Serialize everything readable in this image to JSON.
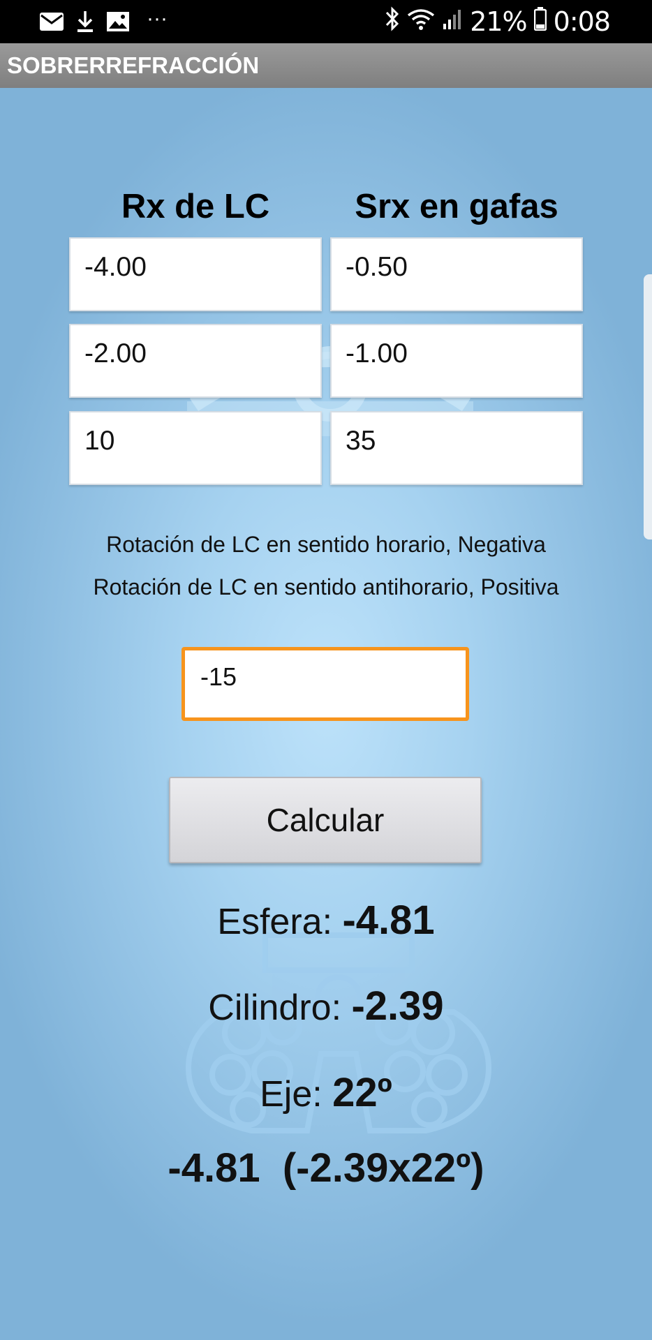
{
  "status_bar": {
    "battery_percent": "21%",
    "time": "0:08",
    "icons": [
      "mail-icon",
      "download-icon",
      "image-icon",
      "more-icon",
      "bluetooth-icon",
      "wifi-icon",
      "signal-icon",
      "battery-icon"
    ],
    "more": "···"
  },
  "app": {
    "title": "SOBRERREFRACCIÓN"
  },
  "columns": {
    "lc_header": "Rx de LC",
    "gafas_header": "Srx en gafas"
  },
  "inputs": {
    "lc_sphere": "-4.00",
    "gafas_sphere": "-0.50",
    "lc_cylinder": "-2.00",
    "gafas_cylinder": "-1.00",
    "lc_axis": "10",
    "gafas_axis": "35"
  },
  "notes": {
    "line1": "Rotación de LC en sentido horario, Negativa",
    "line2": "Rotación de LC en sentido antihorario, Positiva"
  },
  "rotation": {
    "value": "-15"
  },
  "calc_button": {
    "label": "Calcular"
  },
  "results": {
    "sphere_label": "Esfera:",
    "sphere_value": "-4.81",
    "cylinder_label": "Cilindro:",
    "cylinder_value": "-2.39",
    "axis_label": "Eje:",
    "axis_value": "22º",
    "summary": "-4.81  (-2.39x22º)"
  },
  "colors": {
    "accent": "#f7941d",
    "title_bar": "#8a8a8a",
    "background": "#a6d2f0"
  }
}
